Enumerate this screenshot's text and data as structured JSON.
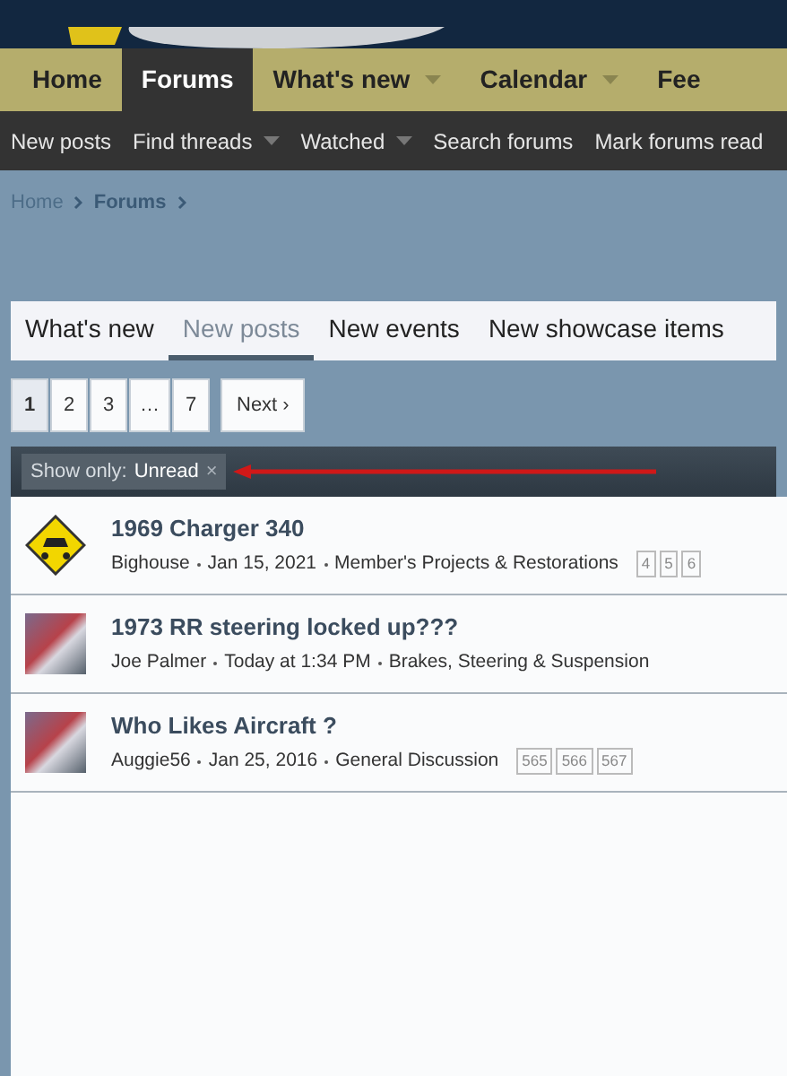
{
  "nav": {
    "tabs": [
      {
        "label": "Home",
        "selected": false,
        "has_menu": false
      },
      {
        "label": "Forums",
        "selected": true,
        "has_menu": false
      },
      {
        "label": "What's new",
        "selected": false,
        "has_menu": true
      },
      {
        "label": "Calendar",
        "selected": false,
        "has_menu": true
      },
      {
        "label": "Fee",
        "selected": false,
        "has_menu": false
      }
    ]
  },
  "subnav": {
    "items": [
      {
        "label": "New posts",
        "has_menu": false
      },
      {
        "label": "Find threads",
        "has_menu": true
      },
      {
        "label": "Watched",
        "has_menu": true
      },
      {
        "label": "Search forums",
        "has_menu": false
      },
      {
        "label": "Mark forums read",
        "has_menu": false
      }
    ]
  },
  "breadcrumb": [
    "Home",
    "Forums"
  ],
  "tabs": [
    {
      "label": "What's new",
      "selected": false
    },
    {
      "label": "New posts",
      "selected": true
    },
    {
      "label": "New events",
      "selected": false
    },
    {
      "label": "New showcase items",
      "selected": false
    }
  ],
  "pagination": {
    "pages": [
      {
        "label": "1",
        "selected": true
      },
      {
        "label": "2",
        "selected": false
      },
      {
        "label": "3",
        "selected": false
      },
      {
        "label": "…",
        "selected": false
      },
      {
        "label": "7",
        "selected": false
      }
    ],
    "next": "Next ›"
  },
  "filter": {
    "label": "Show only:",
    "value": "Unread",
    "remove": "×"
  },
  "threads": [
    {
      "kind": "sign",
      "title": "1969 Charger 340",
      "author": "Bighouse",
      "date": "Jan 15, 2021",
      "forum": "Member's Projects & Restorations",
      "pages": [
        "4",
        "5",
        "6"
      ]
    },
    {
      "kind": "photo",
      "title": "1973 RR steering locked up???",
      "author": "Joe Palmer",
      "date": "Today at 1:34 PM",
      "forum": "Brakes, Steering & Suspension"
    },
    {
      "kind": "photo",
      "title": "Who Likes Aircraft ?",
      "author": "Auggie56",
      "date": "Jan 25, 2016",
      "forum": "General Discussion",
      "pages": [
        "565",
        "566",
        "567"
      ]
    }
  ]
}
